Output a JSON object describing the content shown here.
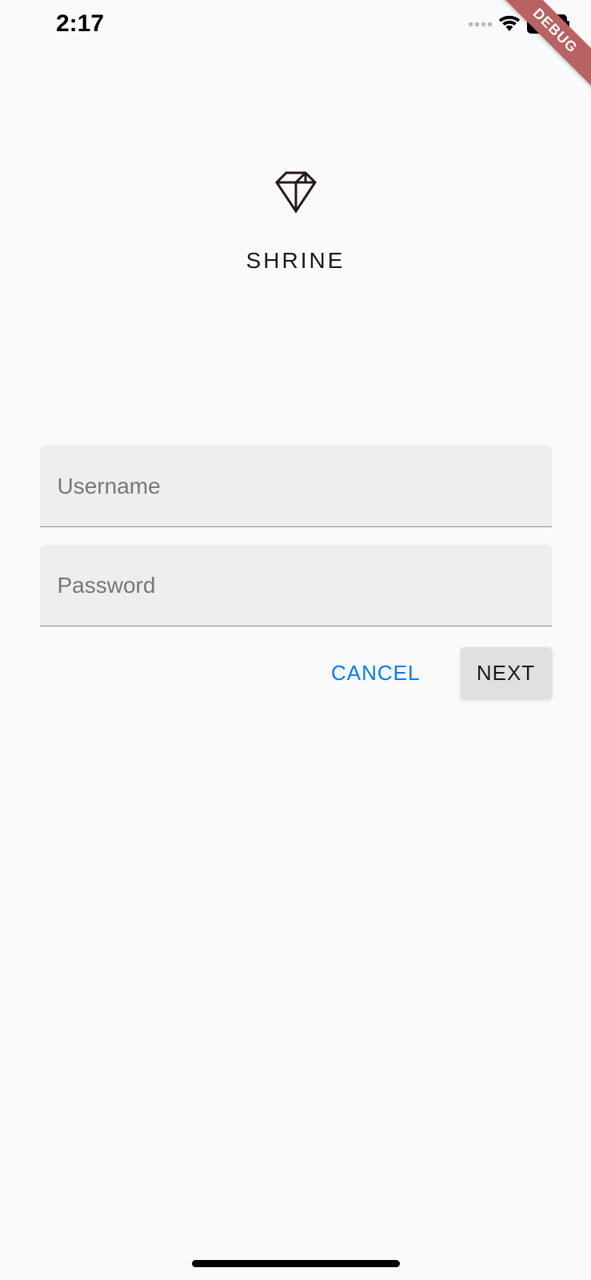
{
  "status_bar": {
    "time": "2:17"
  },
  "debug_banner": "DEBUG",
  "app": {
    "title": "SHRINE"
  },
  "form": {
    "username_placeholder": "Username",
    "username_value": "",
    "password_placeholder": "Password",
    "password_value": ""
  },
  "buttons": {
    "cancel": "CANCEL",
    "next": "NEXT"
  }
}
